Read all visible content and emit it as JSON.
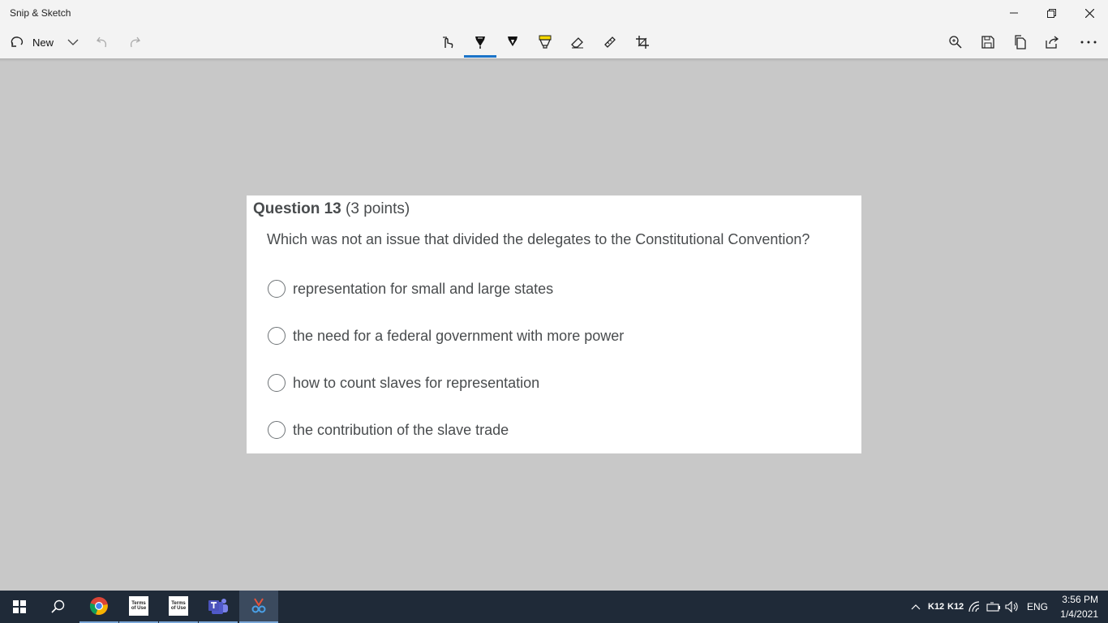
{
  "window": {
    "title": "Snip & Sketch",
    "controls": [
      "minimize-icon",
      "restore-icon",
      "close-icon"
    ]
  },
  "toolbar": {
    "new_label": "New",
    "left_tools": [
      "new-snip-icon",
      "chevron-down-icon",
      "undo-icon",
      "redo-icon"
    ],
    "center_tools": [
      "touch-writing-icon",
      "ballpoint-pen-icon",
      "pencil-icon",
      "highlighter-icon",
      "eraser-icon",
      "ruler-icon",
      "crop-icon"
    ],
    "selected_tool": "ballpoint-pen-icon",
    "right_tools": [
      "zoom-icon",
      "save-icon",
      "copy-icon",
      "share-icon",
      "more-icon"
    ],
    "accent_color": "#1a73c8",
    "highlighter_color": "#f5d800"
  },
  "question": {
    "number": "Question 13",
    "points": "(3 points)",
    "text": "Which was not an issue that divided the delegates to the Constitutional Convention?",
    "options": [
      {
        "label": "representation for small and large states"
      },
      {
        "label": "the need for a federal government with more power"
      },
      {
        "label": "how to count slaves for representation"
      },
      {
        "label": "the contribution of the slave trade"
      }
    ]
  },
  "taskbar": {
    "apps": [
      "start-icon",
      "search-icon",
      "chrome-icon",
      "terms-of-use-icon",
      "terms-of-use-icon",
      "teams-icon",
      "snip-sketch-icon"
    ],
    "terms_icon_text": "Terms of Use",
    "tray": {
      "k12_1": "K12",
      "k12_2": "K12",
      "language": "ENG"
    },
    "time": "3:56 PM",
    "date": "1/4/2021",
    "background_color": "#1f2a38"
  }
}
